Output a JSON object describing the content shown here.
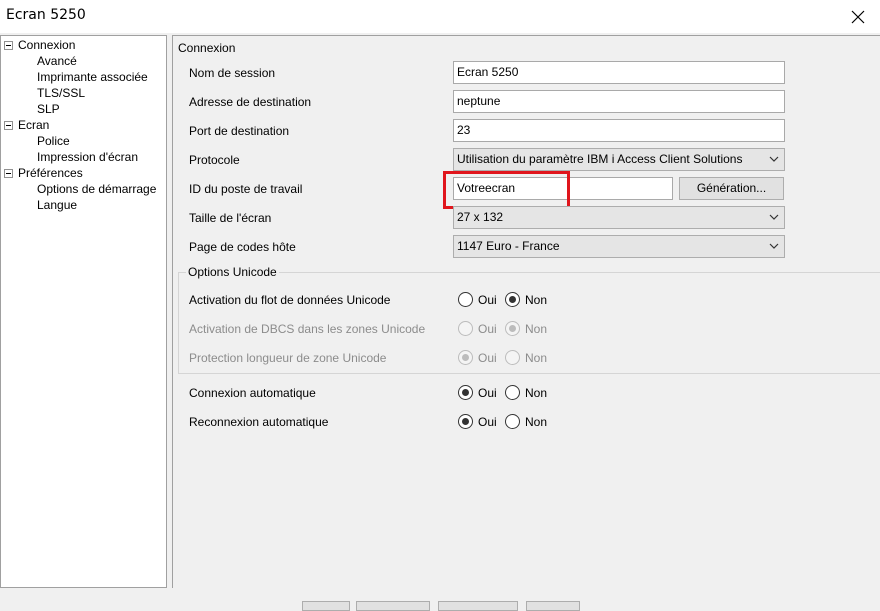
{
  "window": {
    "title": "Ecran 5250"
  },
  "tree": [
    {
      "label": "Connexion",
      "level": 0,
      "expander": true
    },
    {
      "label": "Avancé",
      "level": 1
    },
    {
      "label": "Imprimante associée",
      "level": 1
    },
    {
      "label": "TLS/SSL",
      "level": 1
    },
    {
      "label": "SLP",
      "level": 1
    },
    {
      "label": "Ecran",
      "level": 0,
      "expander": true
    },
    {
      "label": "Police",
      "level": 1
    },
    {
      "label": "Impression d'écran",
      "level": 1
    },
    {
      "label": "Préférences",
      "level": 0,
      "expander": true
    },
    {
      "label": "Options de démarrage",
      "level": 1
    },
    {
      "label": "Langue",
      "level": 1
    }
  ],
  "panel": {
    "heading": "Connexion",
    "session_name": {
      "label": "Nom de session",
      "value": "Ecran 5250"
    },
    "destination_address": {
      "label": "Adresse de destination",
      "value": "neptune"
    },
    "destination_port": {
      "label": "Port de destination",
      "value": "23"
    },
    "protocol": {
      "label": "Protocole",
      "value": "Utilisation du paramètre IBM i Access Client Solutions"
    },
    "workstation_id": {
      "label": "ID du poste de travail",
      "value": "Votreecran",
      "generate_button": "Génération..."
    },
    "screen_size": {
      "label": "Taille de l'écran",
      "value": "27 x 132"
    },
    "host_code_page": {
      "label": "Page de codes hôte",
      "value": "1147 Euro - France"
    }
  },
  "unicode_options": {
    "title": "Options Unicode",
    "rows": [
      {
        "label": "Activation du flot de données Unicode",
        "yes": "Oui",
        "no": "Non",
        "selected": "Non",
        "enabled": true
      },
      {
        "label": "Activation de DBCS dans les zones Unicode",
        "yes": "Oui",
        "no": "Non",
        "selected": "Non",
        "enabled": false
      },
      {
        "label": "Protection longueur de zone Unicode",
        "yes": "Oui",
        "no": "Non",
        "selected": "Oui",
        "enabled": false
      }
    ]
  },
  "auto_connect": {
    "label": "Connexion automatique",
    "yes": "Oui",
    "no": "Non",
    "selected": "Oui"
  },
  "auto_reconnect": {
    "label": "Reconnexion automatique",
    "yes": "Oui",
    "no": "Non",
    "selected": "Oui"
  },
  "colors": {
    "highlight": "#e0151c",
    "panel_bg": "#f0f0f0"
  }
}
